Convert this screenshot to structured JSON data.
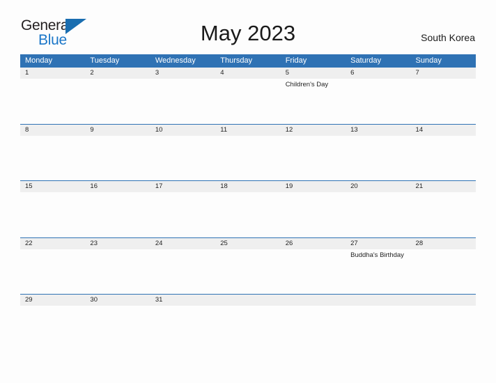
{
  "brand": {
    "name_part1": "General",
    "name_part2": "Blue",
    "triangle_icon": "triangle-icon",
    "accent_color": "#1a76c8",
    "triangle_color": "#1a6eb0"
  },
  "header": {
    "title": "May 2023",
    "region": "South Korea"
  },
  "calendar": {
    "header_color": "#2f72b4",
    "day_band_color": "#efefef",
    "weekdays": [
      "Monday",
      "Tuesday",
      "Wednesday",
      "Thursday",
      "Friday",
      "Saturday",
      "Sunday"
    ],
    "weeks": [
      {
        "days": [
          {
            "num": "1",
            "events": []
          },
          {
            "num": "2",
            "events": []
          },
          {
            "num": "3",
            "events": []
          },
          {
            "num": "4",
            "events": []
          },
          {
            "num": "5",
            "events": [
              "Children's Day"
            ]
          },
          {
            "num": "6",
            "events": []
          },
          {
            "num": "7",
            "events": []
          }
        ]
      },
      {
        "days": [
          {
            "num": "8",
            "events": []
          },
          {
            "num": "9",
            "events": []
          },
          {
            "num": "10",
            "events": []
          },
          {
            "num": "11",
            "events": []
          },
          {
            "num": "12",
            "events": []
          },
          {
            "num": "13",
            "events": []
          },
          {
            "num": "14",
            "events": []
          }
        ]
      },
      {
        "days": [
          {
            "num": "15",
            "events": []
          },
          {
            "num": "16",
            "events": []
          },
          {
            "num": "17",
            "events": []
          },
          {
            "num": "18",
            "events": []
          },
          {
            "num": "19",
            "events": []
          },
          {
            "num": "20",
            "events": []
          },
          {
            "num": "21",
            "events": []
          }
        ]
      },
      {
        "days": [
          {
            "num": "22",
            "events": []
          },
          {
            "num": "23",
            "events": []
          },
          {
            "num": "24",
            "events": []
          },
          {
            "num": "25",
            "events": []
          },
          {
            "num": "26",
            "events": []
          },
          {
            "num": "27",
            "events": [
              "Buddha's Birthday"
            ]
          },
          {
            "num": "28",
            "events": []
          }
        ]
      },
      {
        "days": [
          {
            "num": "29",
            "events": []
          },
          {
            "num": "30",
            "events": []
          },
          {
            "num": "31",
            "events": []
          },
          {
            "num": "",
            "events": []
          },
          {
            "num": "",
            "events": []
          },
          {
            "num": "",
            "events": []
          },
          {
            "num": "",
            "events": []
          }
        ]
      }
    ]
  }
}
